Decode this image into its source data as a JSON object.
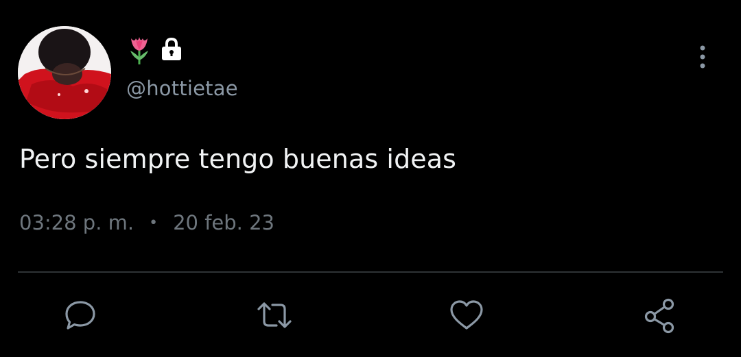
{
  "author": {
    "display_emoji": "tulip",
    "locked_icon": "lock-icon",
    "handle": "@hottietae"
  },
  "tweet": {
    "text": "Pero siempre tengo buenas ideas",
    "time": "03:28 p. m.",
    "separator": "•",
    "date": "20 feb. 23"
  },
  "actions": [
    {
      "name": "reply",
      "icon": "comment-icon"
    },
    {
      "name": "retweet",
      "icon": "retweet-icon"
    },
    {
      "name": "like",
      "icon": "heart-icon"
    },
    {
      "name": "share",
      "icon": "share-icon"
    }
  ],
  "colors": {
    "background": "#000000",
    "text": "#f1f3f4",
    "secondary": "#8b98a5",
    "muted": "#6e767d",
    "divider": "#2f3336"
  }
}
